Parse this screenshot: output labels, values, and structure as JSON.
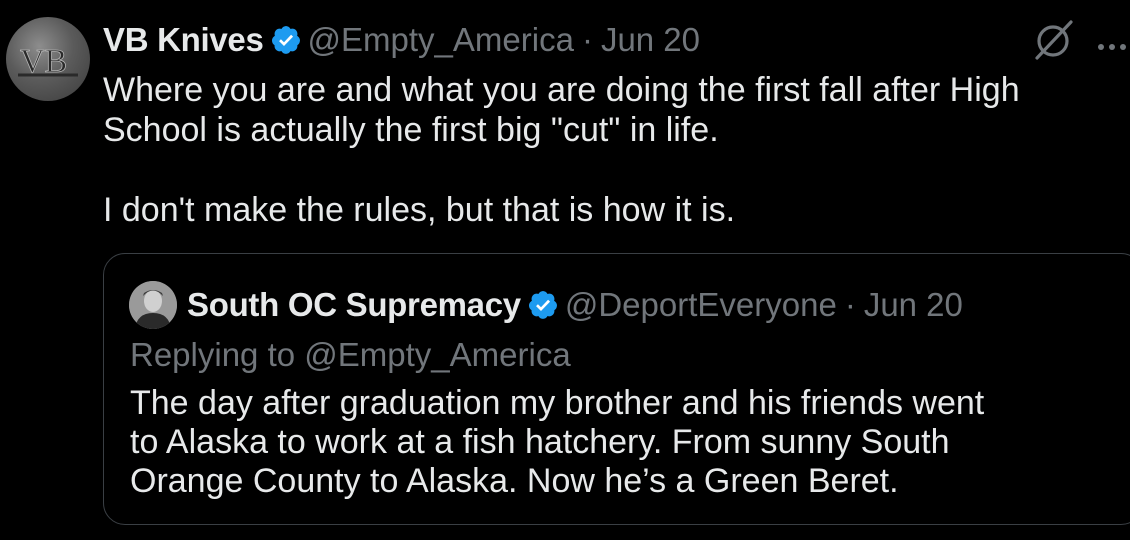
{
  "tweet": {
    "author_name": "VB Knives",
    "avatar_text": "VB",
    "handle": "@Empty_America",
    "separator": "·",
    "date": "Jun 20",
    "text": "Where you are and what you are doing the first fall after High\nSchool is actually the first big \"cut\" in life.\n\nI don't make the rules, but that is how it is.",
    "icons": {
      "verified": "verified-badge-icon",
      "hide": "hide-slash-icon",
      "more": "more-dots-icon"
    }
  },
  "quoted_tweet": {
    "author_name": "South OC Supremacy",
    "handle": "@DeportEveryone",
    "separator": "·",
    "date": "Jun 20",
    "replying_to": "Replying to @Empty_America",
    "text": "The day after graduation my brother and his friends went\nto Alaska to work at a fish hatchery. From sunny South\nOrange County to Alaska. Now he’s a Green Beret."
  },
  "colors": {
    "background": "#000000",
    "primary_text": "#e7e9ea",
    "secondary_text": "#71767b",
    "verified_blue": "#1d9bf0",
    "border": "#3a3f44"
  }
}
